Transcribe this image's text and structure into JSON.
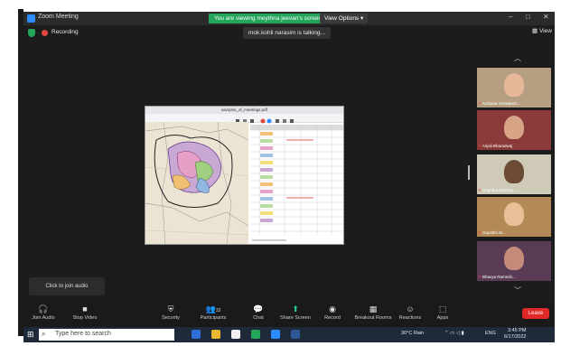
{
  "titlebar": {
    "app_title": "Zoom Meeting",
    "banner": "You are viewing meythna jeevan's screen",
    "view_options": "View Options ▾",
    "minimize": "–",
    "maximize": "□",
    "close": "✕"
  },
  "meeting": {
    "recording_label": "Recording",
    "talking": "mok.kohli narasim is talking...",
    "view_label": "View"
  },
  "shared_screen": {
    "doc_title": "analysis_of_meetings.pdf"
  },
  "participants": [
    {
      "name": "Archana Venkatesh...",
      "bg": "#b69e83",
      "face": "#e7b79a"
    },
    {
      "name": "Anjali Bharadwaj",
      "bg": "#8b3a3a",
      "face": "#d8a488"
    },
    {
      "name": "Chandra Krishna...",
      "bg": "#cfc9b8",
      "face": "#6b4b34"
    },
    {
      "name": "Gayathri M...",
      "bg": "#b38a55",
      "face": "#e8c098"
    },
    {
      "name": "Bhavya Ramesh...",
      "bg": "#5a3b55",
      "face": "#c48a7a"
    }
  ],
  "popup": {
    "label": "Click to join audio"
  },
  "toolbar": {
    "join_audio": "Join Audio",
    "stop_video": "Stop Video",
    "security": "Security",
    "participants": "Participants",
    "participants_count": "32",
    "chat": "Chat",
    "share_screen": "Share Screen",
    "record": "Record",
    "breakout_rooms": "Breakout Rooms",
    "reactions": "Reactions",
    "apps": "Apps",
    "leave": "Leave"
  },
  "taskbar": {
    "search_placeholder": "Type here to search",
    "weather": "30°C Rain",
    "lang": "ENG",
    "time": "3:45 PM",
    "date": "6/17/2022"
  },
  "colors": {
    "accent_green": "#23a55a",
    "leave_red": "#e02828",
    "zoom_blue": "#2d8cff"
  }
}
